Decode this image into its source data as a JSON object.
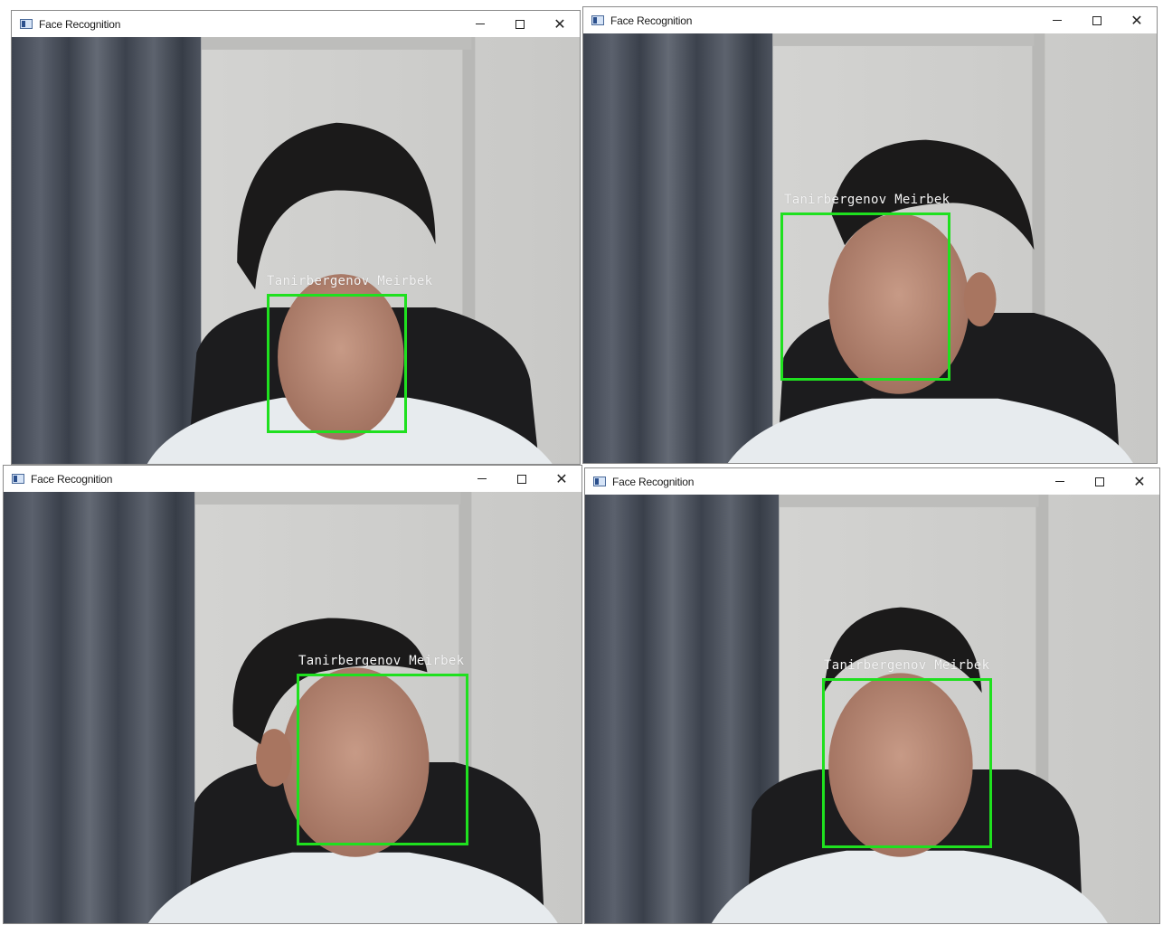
{
  "windows": [
    {
      "title": "Face Recognition",
      "controls": {
        "minimize": "–",
        "maximize": "☐",
        "close": "✕"
      },
      "detection": {
        "label": "Tanirbergenov Meirbek"
      }
    },
    {
      "title": "Face Recognition",
      "controls": {
        "minimize": "–",
        "maximize": "☐",
        "close": "✕"
      },
      "detection": {
        "label": "Tanirbergenov Meirbek"
      }
    },
    {
      "title": "Face Recognition",
      "controls": {
        "minimize": "–",
        "maximize": "☐",
        "close": "✕"
      },
      "detection": {
        "label": "Tanirbergenov Meirbek"
      }
    },
    {
      "title": "Face Recognition",
      "controls": {
        "minimize": "–",
        "maximize": "☐",
        "close": "✕"
      },
      "detection": {
        "label": "Tanirbergenov Meirbek"
      }
    }
  ],
  "colors": {
    "bbox": "#1fe01f",
    "label": "#f4f4f4",
    "titlebar": "#ffffff"
  }
}
